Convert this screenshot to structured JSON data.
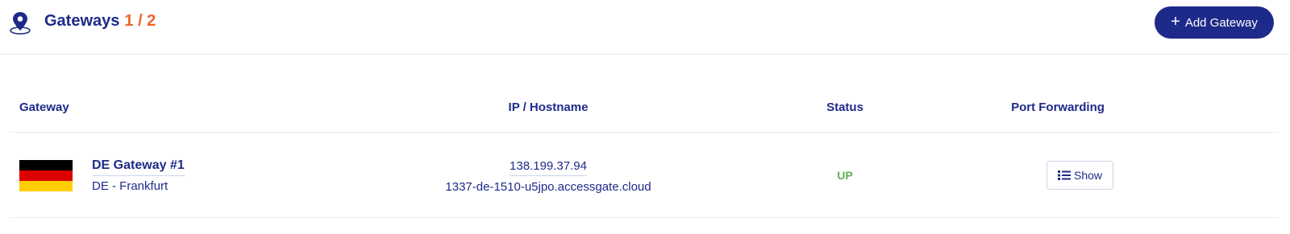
{
  "header": {
    "title": "Gateways",
    "count": "1 / 2",
    "icon": "map-pin-icon",
    "add_button_label": "Add Gateway",
    "add_button_icon": "plus-icon"
  },
  "table": {
    "columns": [
      "Gateway",
      "IP / Hostname",
      "Status",
      "Port Forwarding"
    ],
    "rows": [
      {
        "flag": "germany-flag-icon",
        "name": "DE Gateway #1",
        "location": "DE - Frankfurt",
        "ip": "138.199.37.94",
        "hostname": "1337-de-1510-u5jpo.accessgate.cloud",
        "status": "UP",
        "port_forwarding_label": "Show",
        "port_forwarding_icon": "list-icon"
      }
    ]
  },
  "colors": {
    "primary": "#1e2a8a",
    "accent": "#f0632a",
    "status_up": "#5fae4f",
    "border": "#e9ebf0"
  }
}
